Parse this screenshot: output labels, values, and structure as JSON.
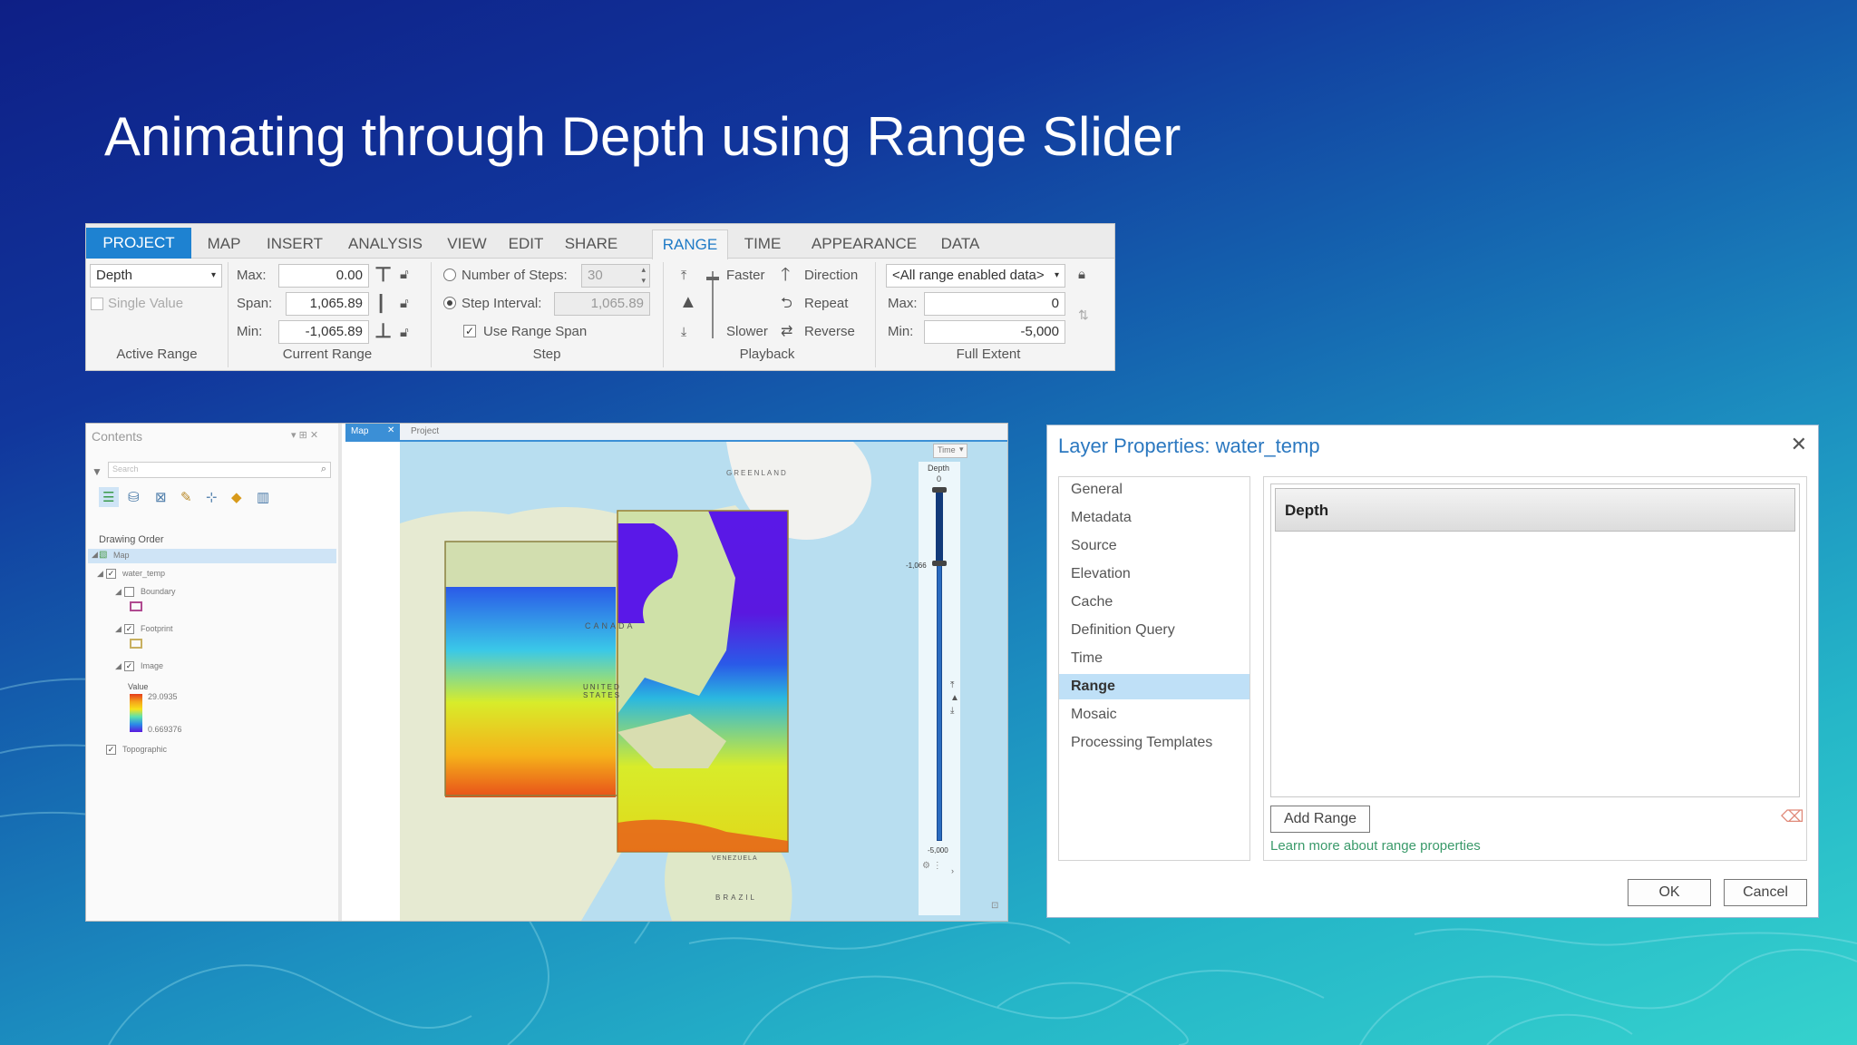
{
  "slide": {
    "title": "Animating through Depth using Range Slider"
  },
  "ribbon": {
    "tabs": [
      "PROJECT",
      "MAP",
      "INSERT",
      "ANALYSIS",
      "VIEW",
      "EDIT",
      "SHARE",
      "RANGE",
      "TIME",
      "APPEARANCE",
      "DATA"
    ],
    "active_tab": "RANGE",
    "active_range": {
      "dropdown_value": "Depth",
      "single_value_label": "Single Value",
      "group_label": "Active Range"
    },
    "current_range": {
      "max_label": "Max:",
      "max_value": "0.00",
      "span_label": "Span:",
      "span_value": "1,065.89",
      "min_label": "Min:",
      "min_value": "-1,065.89",
      "group_label": "Current Range"
    },
    "step": {
      "num_steps_label": "Number of Steps:",
      "num_steps_value": "30",
      "interval_label": "Step Interval:",
      "interval_value": "1,065.89",
      "use_span_label": "Use Range Span",
      "group_label": "Step"
    },
    "playback": {
      "faster": "Faster",
      "slower": "Slower",
      "direction": "Direction",
      "repeat": "Repeat",
      "reverse": "Reverse",
      "group_label": "Playback"
    },
    "full_extent": {
      "dropdown_value": "<All range enabled data>",
      "max_label": "Max:",
      "max_value": "0",
      "min_label": "Min:",
      "min_value": "-5,000",
      "group_label": "Full Extent"
    }
  },
  "contents": {
    "title": "Contents",
    "search_placeholder": "Search",
    "drawing_order": "Drawing Order",
    "layers": [
      "Map",
      "water_temp",
      "Boundary",
      "Footprint",
      "Image"
    ],
    "value_label": "Value",
    "value_high": "29.0935",
    "value_low": "0.669376",
    "basemap_layer": "Topographic"
  },
  "map": {
    "tabs": [
      "Map",
      "Project"
    ],
    "time_label": "Time",
    "labels": {
      "greenland": "GREENLAND",
      "canada": "CANADA",
      "united_states": "UNITED STATES",
      "brazil": "BRAZIL",
      "venezuela": "VENEZUELA"
    },
    "depth_slider": {
      "title": "Depth",
      "top_value": "0",
      "marker_value": "-1,066",
      "bottom_value": "-5,000",
      "level_fraction": 0.21
    }
  },
  "dialog": {
    "title": "Layer Properties: water_temp",
    "nav": [
      "General",
      "Metadata",
      "Source",
      "Elevation",
      "Cache",
      "Definition Query",
      "Time",
      "Range",
      "Mosaic",
      "Processing Templates"
    ],
    "selected": "Range",
    "range_item": "Depth",
    "add_range": "Add Range",
    "learn_more": "Learn more about range properties",
    "ok": "OK",
    "cancel": "Cancel"
  },
  "colors": {
    "accent": "#1e82d1",
    "title_link": "#2b78c0",
    "selection": "#bfe0f7"
  }
}
